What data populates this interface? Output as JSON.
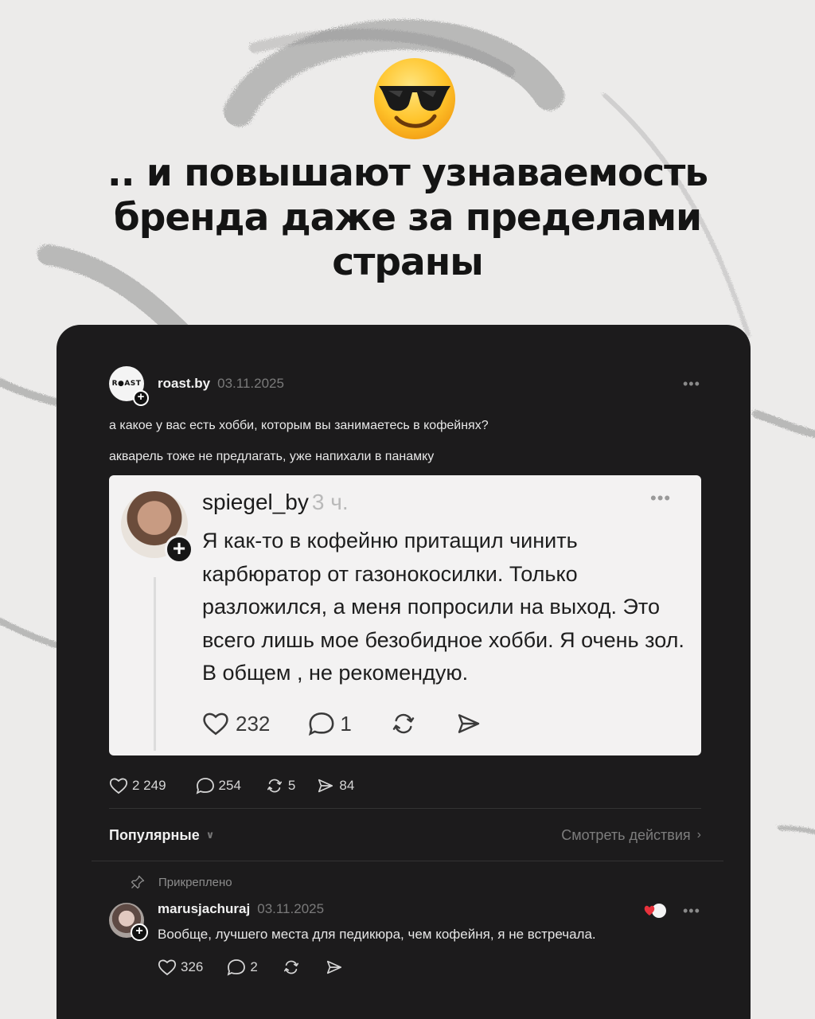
{
  "headline": {
    "line1": ".. и повышают узнаваемость",
    "line2": "бренда даже за пределами",
    "line3": "страны"
  },
  "emoji": "smiling-face-with-sunglasses",
  "post": {
    "avatar_logo": "R●AST",
    "username": "roast.by",
    "date": "03.11.2025",
    "more": "•••",
    "text_line1": "а какое у вас есть хобби, которым вы занимаетесь в кофейнях?",
    "text_line2": "акварель тоже не предлагать, уже напихали в панамку",
    "quote": {
      "username": "spiegel_by",
      "time": "3 ч.",
      "more": "•••",
      "text": "Я как-то в кофейню притащил чинить карбюратор от газонокосилки. Только разложился, а меня попросили на выход. Это всего лишь мое безобидное хобби. Я очень зол. В общем , не рекомендую.",
      "likes": "232",
      "replies": "1"
    },
    "stats": {
      "likes": "2 249",
      "replies": "254",
      "reposts": "5",
      "shares": "84"
    }
  },
  "sort": {
    "label": "Популярные",
    "activity_link": "Смотреть действия"
  },
  "pinned_label": "Прикреплено",
  "comment": {
    "username": "marusjachuraj",
    "date": "03.11.2025",
    "more": "•••",
    "text": "Вообще, лучшего места для педикюра, чем кофейня, я не встречала.",
    "likes": "326",
    "replies": "2"
  },
  "colors": {
    "background": "#ecebea",
    "card": "#1c1b1c",
    "quote_card": "#f3f2f2"
  }
}
